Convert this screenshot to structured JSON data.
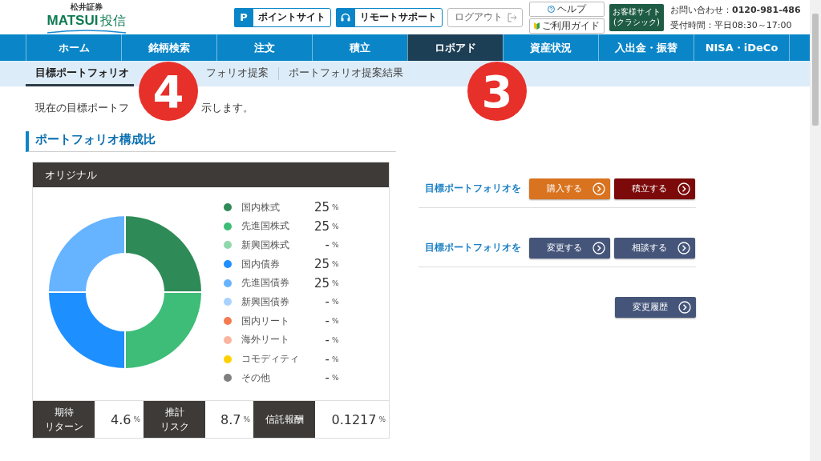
{
  "logo": {
    "company": "松井証券",
    "brand": "MATSUI",
    "suffix": "投信"
  },
  "header_links": [
    {
      "badge": "P",
      "label": "ポイントサイト",
      "kind": "point"
    },
    {
      "label": "リモートサポート",
      "kind": "remote"
    },
    {
      "label": "ログアウト",
      "kind": "logout"
    }
  ],
  "help_links": [
    {
      "label": "ヘルプ",
      "kind": "help"
    },
    {
      "label": "ご利用ガイド",
      "kind": "guide"
    }
  ],
  "classic_site": {
    "lines": [
      "お客様サイト",
      "(クラシック)"
    ]
  },
  "contact": {
    "phone": "お問い合わせ：**0120-981-486**",
    "hours": "受付時間：平日08:30～17:00"
  },
  "nav": [
    {
      "label": "ホーム",
      "selected": false
    },
    {
      "label": "銘柄検索",
      "selected": false
    },
    {
      "label": "注文",
      "selected": false
    },
    {
      "label": "積立",
      "selected": false
    },
    {
      "label": "ロボアド",
      "selected": true
    },
    {
      "label": "資産状況",
      "selected": false
    },
    {
      "label": "入出金・振替",
      "selected": false
    },
    {
      "label": "NISA・iDeCo",
      "selected": false
    }
  ],
  "sub_tabs": [
    {
      "label": "目標ポートフォリオ",
      "selected": true
    },
    {
      "label": "フォリオ提案",
      "selected": false
    },
    {
      "label": "ポートフォリオ提案結果",
      "selected": false
    }
  ],
  "description": [
    "現在の目標ポートフ",
    "示します。"
  ],
  "section_title": "ポートフォリオ構成比",
  "card": {
    "chart_data": {
      "type": "donut",
      "categories": [
        "国内株式",
        "先進国株式",
        "新興国株式",
        "国内債券",
        "先進国債券",
        "新興国債券",
        "国内リート",
        "海外リート",
        "コモディティ",
        "その他"
      ],
      "series": [
        {
          "name": "オリジナル",
          "values": [
            25,
            25,
            null,
            25,
            25,
            null,
            null,
            null,
            null,
            null
          ]
        }
      ]
    },
    "legend": [
      {
        "value": "25",
        "unit": "%",
        "color": "#2e8b57"
      },
      {
        "value": "25",
        "unit": "%",
        "color": "#3dbd77"
      },
      {
        "value": "-",
        "unit": "%",
        "color": "#8fd8ac"
      },
      {
        "value": "25",
        "unit": "%",
        "color": "#1e8fff"
      },
      {
        "value": "25",
        "unit": "%",
        "color": "#66b3ff"
      },
      {
        "value": "-",
        "unit": "%",
        "color": "#a9d2ff"
      },
      {
        "value": "-",
        "unit": "%",
        "color": "#f47b50"
      },
      {
        "value": "-",
        "unit": "%",
        "color": "#f9b5a0"
      },
      {
        "value": "-",
        "unit": "%",
        "color": "#ffd000"
      },
      {
        "value": "-",
        "unit": "%",
        "color": "#808080"
      }
    ],
    "stats": [
      {
        "label": [
          "期待",
          "リターン"
        ],
        "value": "4.6",
        "unit": "%"
      },
      {
        "label": [
          "推計",
          "リスク"
        ],
        "value": "8.7",
        "unit": "%"
      },
      {
        "label": [
          "信託報酬"
        ],
        "value": "0.1217",
        "unit": "%"
      }
    ]
  },
  "actions": [
    {
      "label": "目標ポートフォリオを",
      "buttons": [
        {
          "label": "購入する",
          "color": "#d9731f"
        },
        {
          "label": "積立する",
          "color": "#7c0a0a"
        }
      ]
    },
    {
      "label": "目標ポートフォリオを",
      "buttons": [
        {
          "label": "変更する",
          "color": "#45557a"
        },
        {
          "label": "相談する",
          "color": "#45557a"
        }
      ]
    },
    {
      "buttons": [
        {
          "label": "変更履歴",
          "color": "#45557a"
        }
      ]
    }
  ],
  "markers": [
    {
      "label": "4"
    },
    {
      "label": "3"
    }
  ]
}
